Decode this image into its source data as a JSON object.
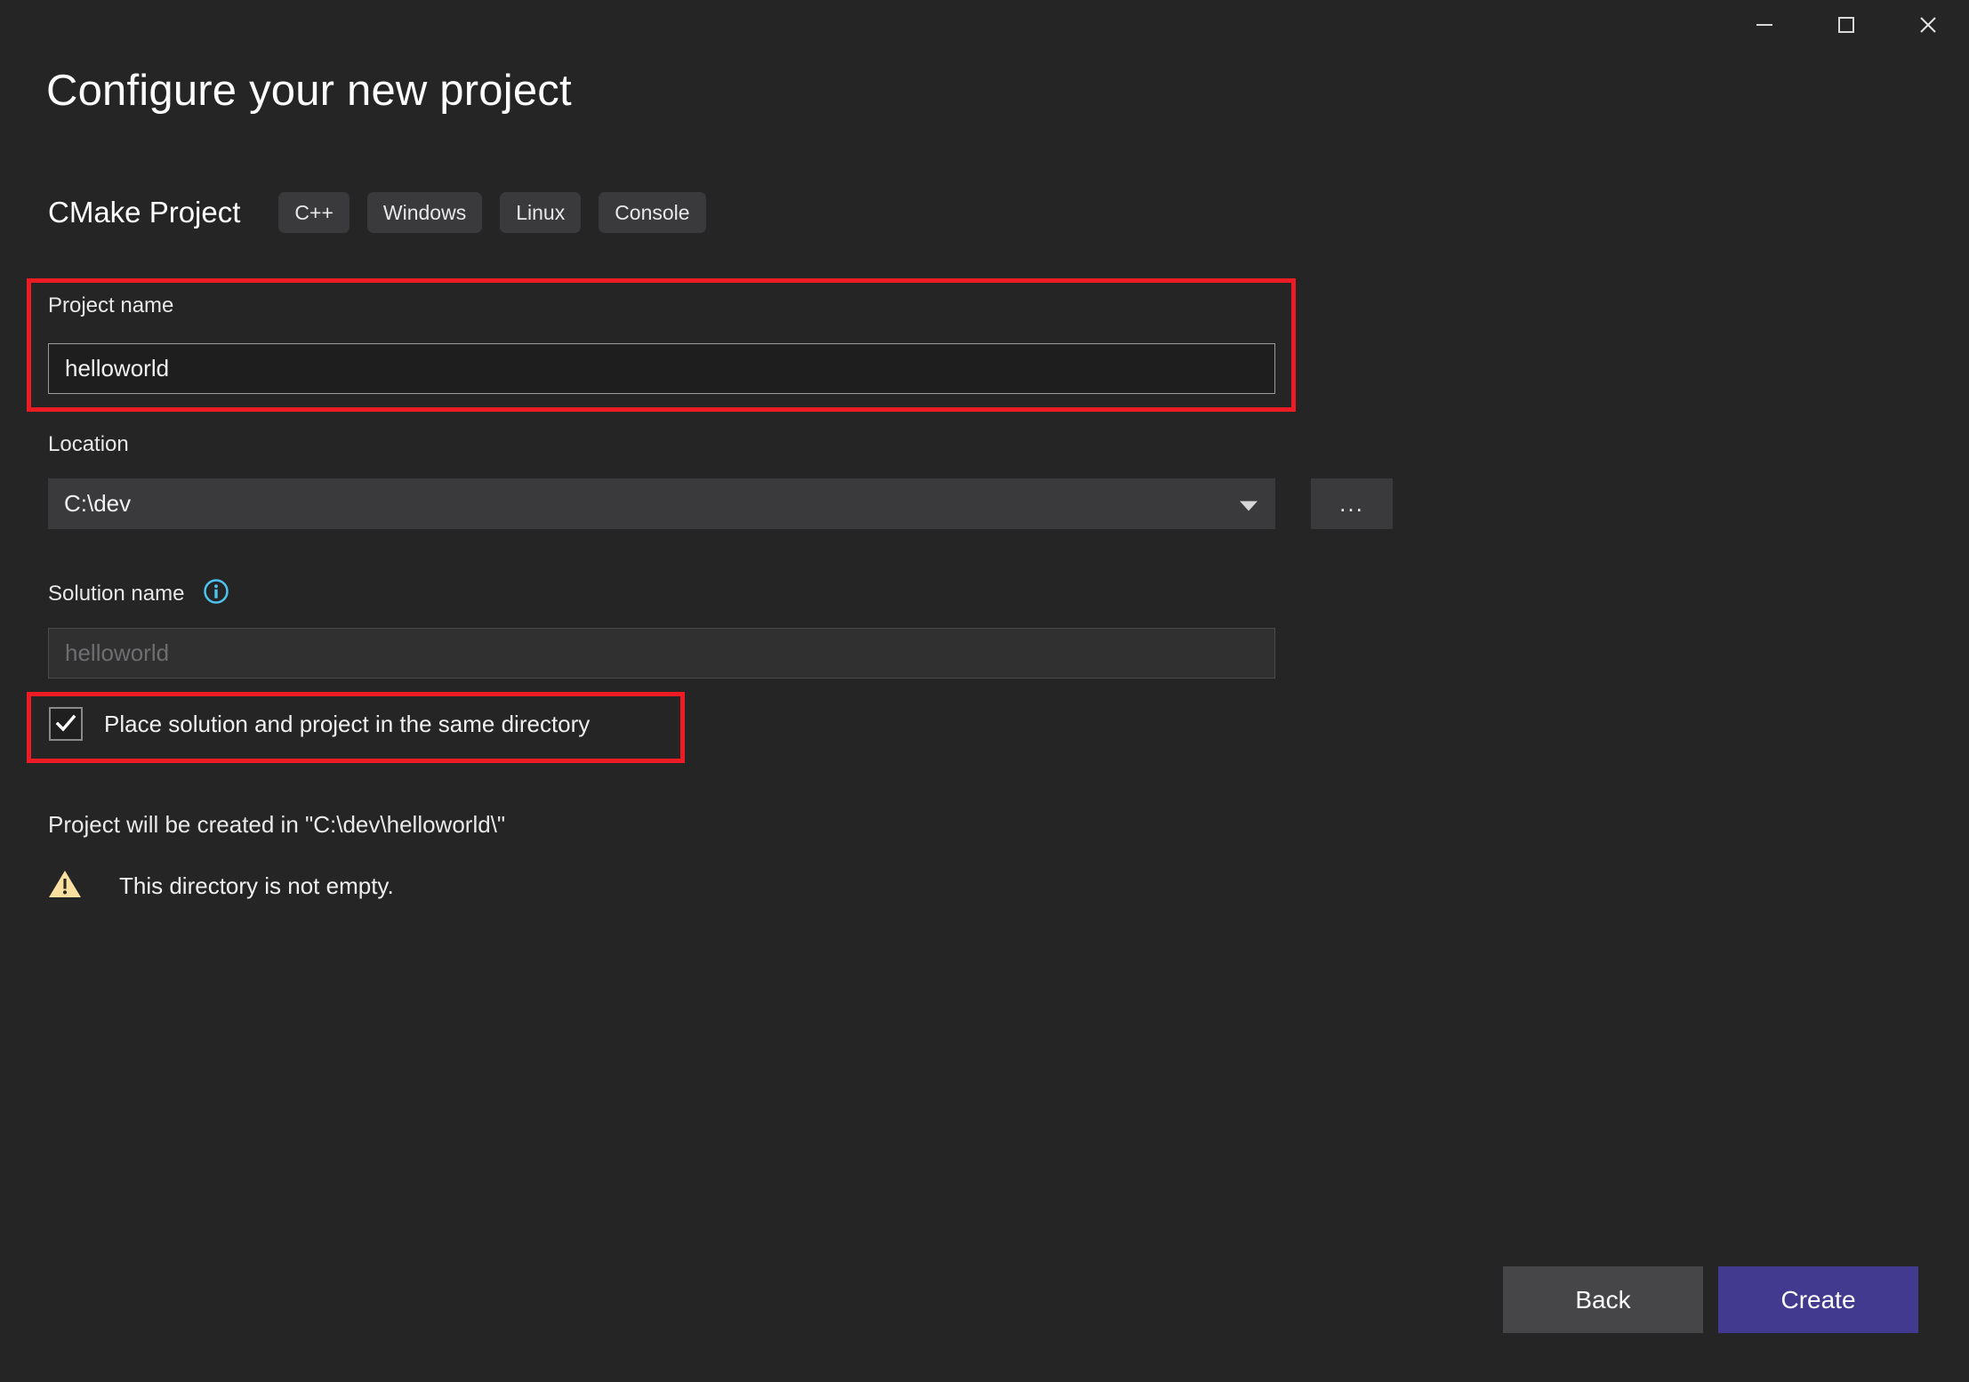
{
  "window": {
    "controls": [
      {
        "name": "minimize",
        "label": "Minimize"
      },
      {
        "name": "maximize",
        "label": "Maximize"
      },
      {
        "name": "close",
        "label": "Close"
      }
    ]
  },
  "header": {
    "title": "Configure your new project",
    "template_name": "CMake Project",
    "tags": [
      "C++",
      "Windows",
      "Linux",
      "Console"
    ]
  },
  "form": {
    "project_name": {
      "label": "Project name",
      "value": "helloworld",
      "highlighted": true
    },
    "location": {
      "label": "Location",
      "value": "C:\\dev",
      "browse_label": "...",
      "caret_icon": "chevron-down-icon"
    },
    "solution_name": {
      "label": "Solution name",
      "info_icon": "info-icon",
      "value": "helloworld",
      "disabled": true
    },
    "same_directory_checkbox": {
      "label": "Place solution and project in the same directory",
      "checked": true,
      "check_glyph": "✓",
      "highlighted": true
    }
  },
  "status": {
    "path_message": "Project will be created in \"C:\\dev\\helloworld\\\"",
    "warning_icon": "warning-triangle-icon",
    "warning_message": "This directory is not empty."
  },
  "footer": {
    "back_label": "Back",
    "create_label": "Create"
  },
  "colors": {
    "background": "#252526",
    "accent_create": "#413a8f",
    "highlight_red": "#ed1c24",
    "info_cyan": "#4ec3ed",
    "warning_amber": "#f9dfa0",
    "input_background": "#1e1e1e",
    "combo_background": "#3a3a3c"
  }
}
